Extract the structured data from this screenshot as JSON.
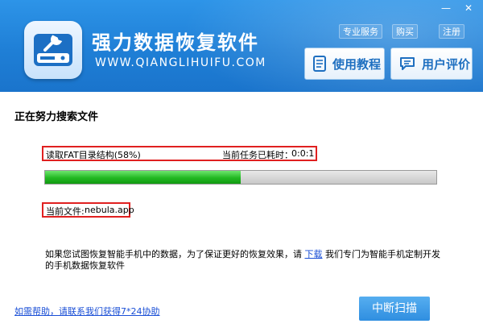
{
  "header": {
    "title": "强力数据恢复软件",
    "subtitle": "WWW.QIANGLIHUIFU.COM",
    "window_controls": [
      "—",
      "✕"
    ],
    "links": [
      {
        "label": "专业服务"
      },
      {
        "label": "购买"
      },
      {
        "label": "注册"
      }
    ],
    "buttons": [
      {
        "label": "使用教程",
        "icon": "document-icon"
      },
      {
        "label": "用户评价",
        "icon": "chat-icon"
      }
    ]
  },
  "main": {
    "title": "正在努力搜索文件",
    "status_label": "读取FAT目录结构(58%)",
    "elapsed_label": "当前任务已耗时：",
    "elapsed_value": "0:0:1",
    "progress_fraction": 0.5,
    "current_file_label": "当前文件:",
    "current_file_value": "nebula.app",
    "notice_before": "如果您试图恢复智能手机中的数据，为了保证更好的恢复效果，请",
    "notice_link": "下载",
    "notice_after": "我们专门为智能手机定制开发的手机数据恢复软件"
  },
  "footer": {
    "help_link": "如需帮助，请联系我们获得7*24协助",
    "stop_button": "中断扫描"
  },
  "colors": {
    "header_blue": "#1f7fd6",
    "highlight_red": "#e02020",
    "progress_green": "#22b822",
    "link_blue": "#1a4fd6"
  }
}
